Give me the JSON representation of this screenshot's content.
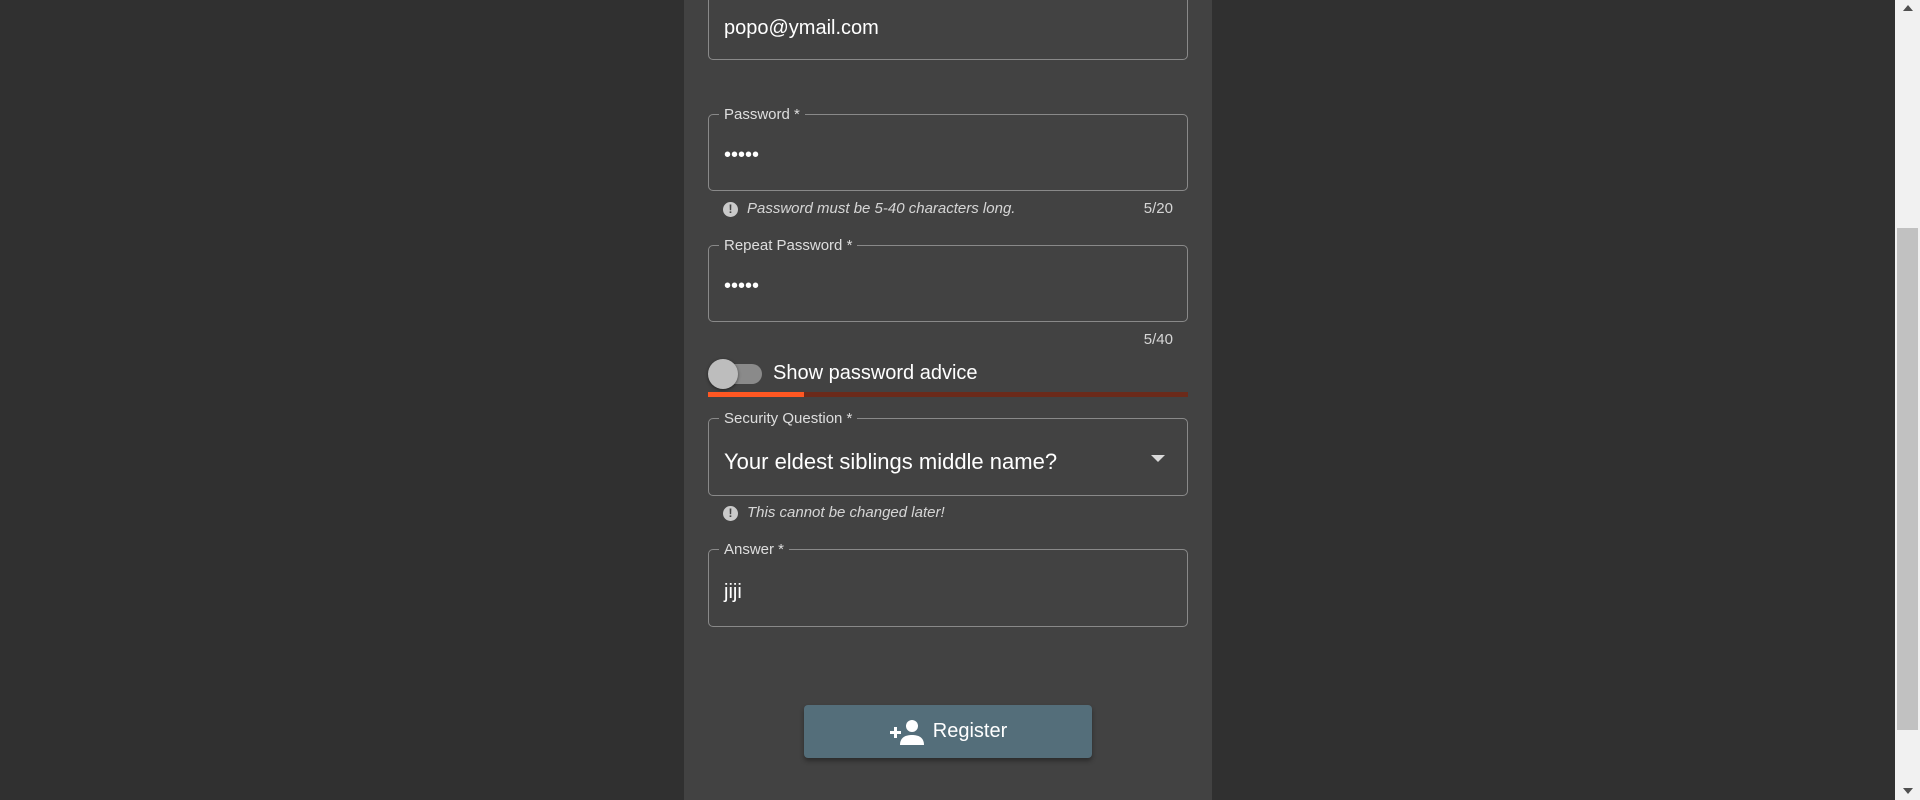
{
  "email": {
    "value": "popo@ymail.com"
  },
  "password": {
    "label": "Password *",
    "value": "•••••",
    "hint": "Password must be 5-40 characters long.",
    "counter": "5/20"
  },
  "repeat_password": {
    "label": "Repeat Password *",
    "value": "•••••",
    "counter": "5/40"
  },
  "password_advice": {
    "label": "Show password advice",
    "enabled": false,
    "strength_fraction": 0.2
  },
  "security_question": {
    "label": "Security Question *",
    "selected": "Your eldest siblings middle name?",
    "hint": "This cannot be changed later!"
  },
  "answer": {
    "label": "Answer *",
    "value": "jiji"
  },
  "register_button": {
    "label": "Register",
    "icon": "person-add-icon"
  },
  "colors": {
    "background": "#303030",
    "card": "#424242",
    "button": "#546e7a",
    "strength_fill": "#ff5722",
    "strength_track": "#6b2a1a"
  },
  "hint_icon": "exclamation-circle-icon"
}
